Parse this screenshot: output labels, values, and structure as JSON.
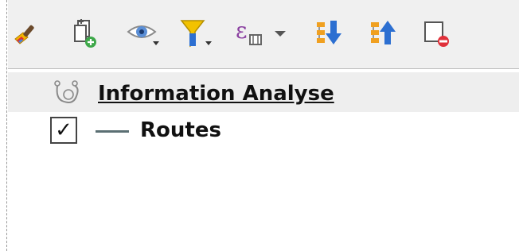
{
  "toolbar": {
    "tools": [
      {
        "icon": "style-brush-icon"
      },
      {
        "icon": "add-group-icon"
      },
      {
        "icon": "eye-visibility-icon"
      },
      {
        "icon": "filter-funnel-icon"
      },
      {
        "icon": "expression-filter-icon"
      },
      {
        "icon": "dropdown-arrow-icon"
      },
      {
        "icon": "expand-all-icon"
      },
      {
        "icon": "collapse-all-icon"
      },
      {
        "icon": "remove-layer-icon"
      }
    ]
  },
  "tree": {
    "group": {
      "label": "Information Analyse",
      "icon": "group-node-icon"
    },
    "layers": [
      {
        "label": "Routes",
        "checked": true,
        "checkmark": "✓",
        "symbol_color": "#5b6f73"
      }
    ]
  },
  "colors": {
    "toolbar_bg": "#f0f0f0",
    "group_row_bg": "#eeeeee",
    "funnel_yellow": "#f2c200",
    "arrow_blue": "#2c6fd1",
    "remove_red": "#e0303a"
  }
}
